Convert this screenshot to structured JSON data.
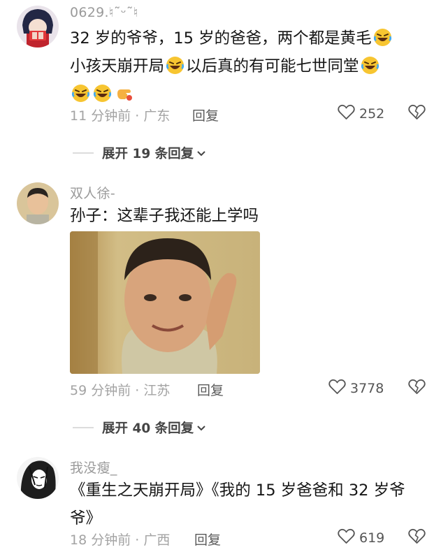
{
  "comments": [
    {
      "username": "0629.♮˜ᵕ˜♮",
      "text_line1": "32 岁的爷爷，15 岁的爸爸，两个都是黄毛",
      "text_line2a": "小孩天崩开局",
      "text_line2b": "以后真的有可能七世同堂",
      "time_location": "11 分钟前 · 广东",
      "reply_label": "回复",
      "likes": "252",
      "expand_label": "展开 19 条回复",
      "emojis": [
        "rolling-laughing-emoji",
        "rolling-laughing-emoji",
        "rolling-laughing-emoji",
        "rolling-laughing-emoji",
        "rolling-laughing-emoji",
        "pointing-hand-emoji"
      ]
    },
    {
      "username": "双人徐-",
      "text": "孙子：这辈子我还能上学吗",
      "image_description_icon": "salute-meme-image",
      "time_location": "59 分钟前 · 江苏",
      "reply_label": "回复",
      "likes": "3778",
      "expand_label": "展开 40 条回复"
    },
    {
      "username": "我没瘦_",
      "text_line1": "《重生之天崩开局》《我的 15 岁爸爸和 32 岁爷",
      "text_line2": "爷》",
      "time_location": "18 分钟前 · 广西",
      "reply_label": "回复",
      "likes": "619"
    }
  ],
  "colors": {
    "meta_gray": "#a3a3a3",
    "text": "#161616",
    "emoji_yellow": "#f7c531"
  },
  "icons": {
    "like": "heart-outline-icon",
    "dislike": "broken-heart-icon",
    "expand": "chevron-down-icon"
  }
}
